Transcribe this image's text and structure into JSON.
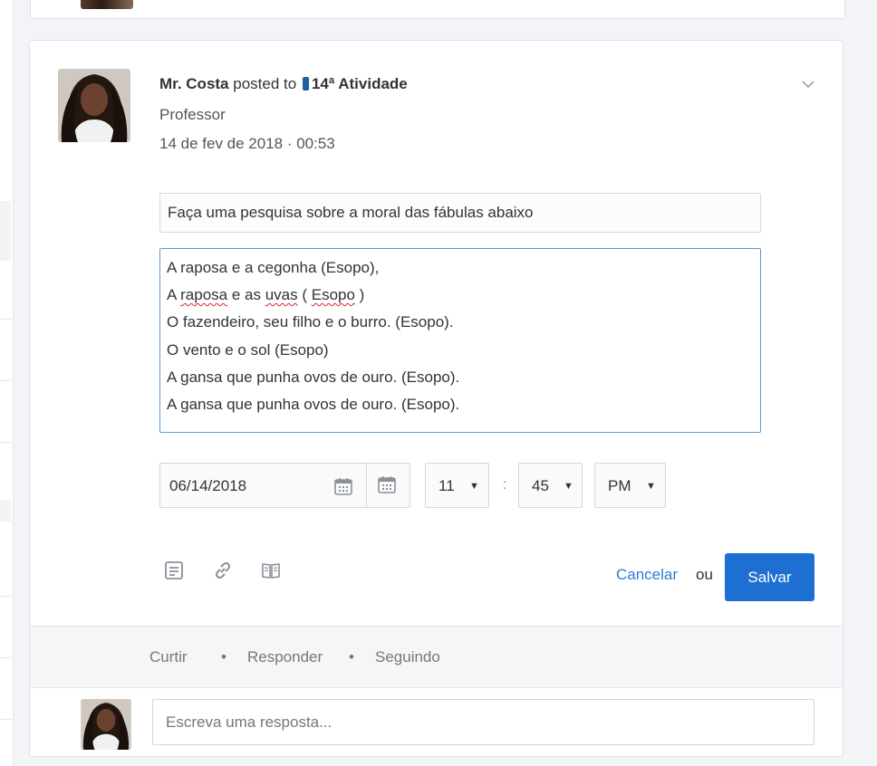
{
  "post": {
    "author": "Mr. Costa",
    "posted_to": "posted to",
    "group": "14ª Atividade",
    "role": "Professor",
    "timestamp": "14 de fev de 2018 · 00:53"
  },
  "editor": {
    "title_value": "Faça uma pesquisa sobre a moral das fábulas abaixo",
    "body_lines": [
      "A raposa e a cegonha (Esopo),",
      "A raposa e as uvas ( Esopo )",
      "O fazendeiro, seu filho e o burro. (Esopo).",
      "O vento e o sol (Esopo)",
      "A gansa que punha ovos de ouro. (Esopo).",
      "A gansa que punha ovos de ouro. (Esopo)."
    ],
    "line2": {
      "a": "A ",
      "b": "raposa",
      "c": " e as ",
      "d": "uvas",
      "e": " ( ",
      "f": "Esopo",
      "g": " )"
    },
    "due_date": "06/14/2018",
    "hour": "11",
    "minute": "45",
    "ampm": "PM",
    "time_separator": ":",
    "cancel_label": "Cancelar",
    "or_label": "ou",
    "save_label": "Salvar"
  },
  "actions": {
    "like": "Curtir",
    "reply": "Responder",
    "following": "Seguindo",
    "separator": "•"
  },
  "reply": {
    "placeholder": "Escreva uma resposta..."
  },
  "colors": {
    "accent": "#1d6fd1",
    "link": "#2a7ed2",
    "group_badge": "#1f5fa8"
  },
  "icons": [
    "chevron-down-icon",
    "calendar-icon",
    "note-icon",
    "link-icon",
    "book-icon"
  ]
}
